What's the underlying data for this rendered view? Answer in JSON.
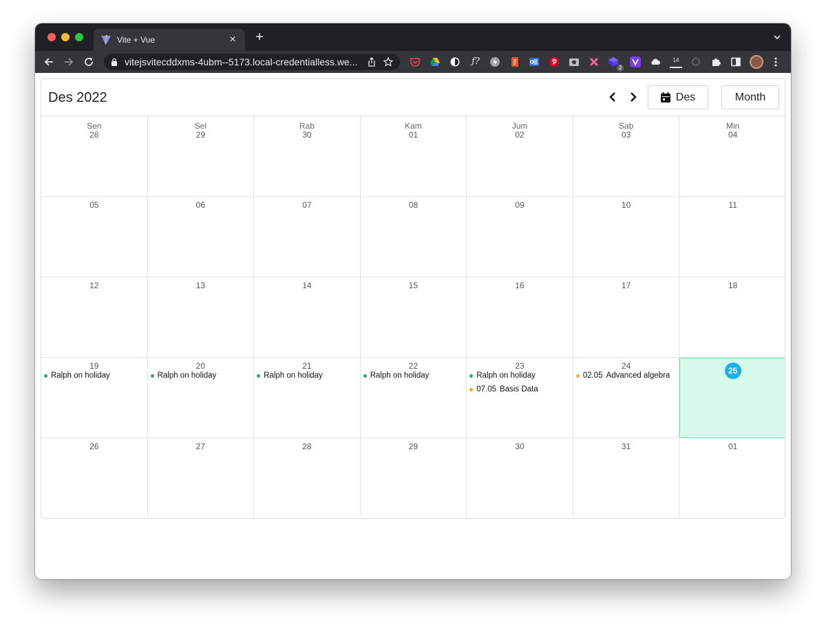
{
  "browser": {
    "tab_title": "Vite + Vue",
    "url": "vitejsvitecddxms-4ubm--5173.local-credentialless.we...",
    "ext_badge_count": "2",
    "ext_counter": "14"
  },
  "calendar": {
    "title": "Des 2022",
    "today_button": "Des",
    "view_button": "Month",
    "weekdays": [
      "Sen",
      "Sel",
      "Rab",
      "Kam",
      "Jum",
      "Sab",
      "Min"
    ],
    "weeks": [
      [
        "28",
        "29",
        "30",
        "01",
        "02",
        "03",
        "04"
      ],
      [
        "05",
        "06",
        "07",
        "08",
        "09",
        "10",
        "11"
      ],
      [
        "12",
        "13",
        "14",
        "15",
        "16",
        "17",
        "18"
      ],
      [
        "19",
        "20",
        "21",
        "22",
        "23",
        "24",
        "25"
      ],
      [
        "26",
        "27",
        "28",
        "29",
        "30",
        "31",
        "01"
      ]
    ],
    "today": "25",
    "events": {
      "ralph": "Ralph on holiday",
      "algebra_time": "02.05",
      "algebra_title": "Advanced algebra",
      "basis_time": "07.05",
      "basis_title": "Basis Data"
    },
    "colors": {
      "holiday_dot": "#2fa57a",
      "class_dot": "#f5a623",
      "today_bg": "#d7fbea",
      "today_badge": "#19b1e8"
    }
  }
}
